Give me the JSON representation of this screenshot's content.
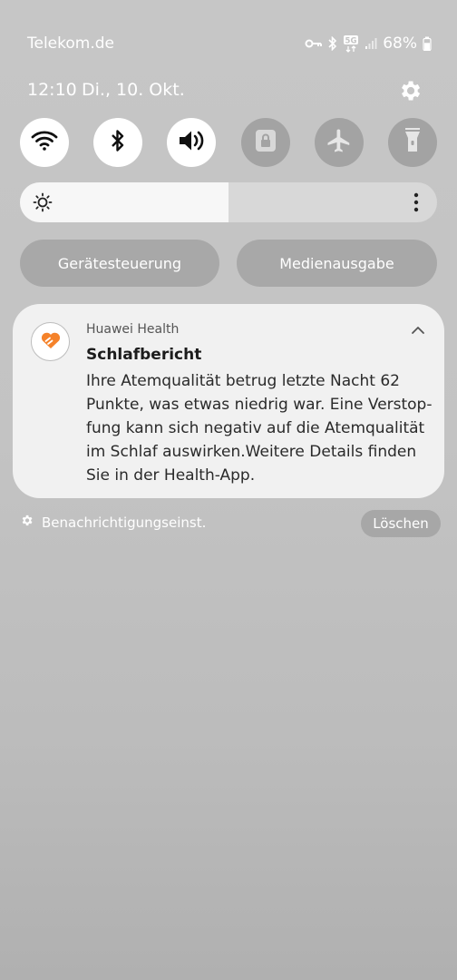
{
  "status_bar": {
    "carrier": "Telekom.de",
    "network": "5G",
    "battery": "68%",
    "battery_level": 0.68,
    "icons": [
      "vpn-key-icon",
      "bluetooth-icon",
      "5g-icon",
      "signal-icon",
      "battery-icon"
    ]
  },
  "header": {
    "time": "12:10",
    "date": "Di., 10. Okt."
  },
  "quick_settings": {
    "tiles": [
      {
        "icon": "wifi-icon",
        "state": "on"
      },
      {
        "icon": "bluetooth-icon",
        "state": "on"
      },
      {
        "icon": "sound-icon",
        "state": "on"
      },
      {
        "icon": "lock-rotation-icon",
        "state": "off"
      },
      {
        "icon": "airplane-icon",
        "state": "off"
      },
      {
        "icon": "flashlight-icon",
        "state": "off"
      }
    ],
    "brightness_level": 0.5,
    "device_control_label": "Gerätesteuerung",
    "media_output_label": "Medienausgabe"
  },
  "notification": {
    "app_name": "Huawei Health",
    "title": "Schlafbericht",
    "body_lines": [
      "Ihre Atemqualität betrug letzte Nacht 62",
      "Punkte, was etwas niedrig war. Eine Verstop-",
      "fung kann sich negativ auf die Atemqualität",
      "im Schlaf auswirken.Weitere Details finden",
      "Sie in der Health-App."
    ],
    "accent_color": "#f5822a"
  },
  "footer": {
    "settings_label": "Benachrichtigungseinst.",
    "clear_label": "Löschen"
  }
}
